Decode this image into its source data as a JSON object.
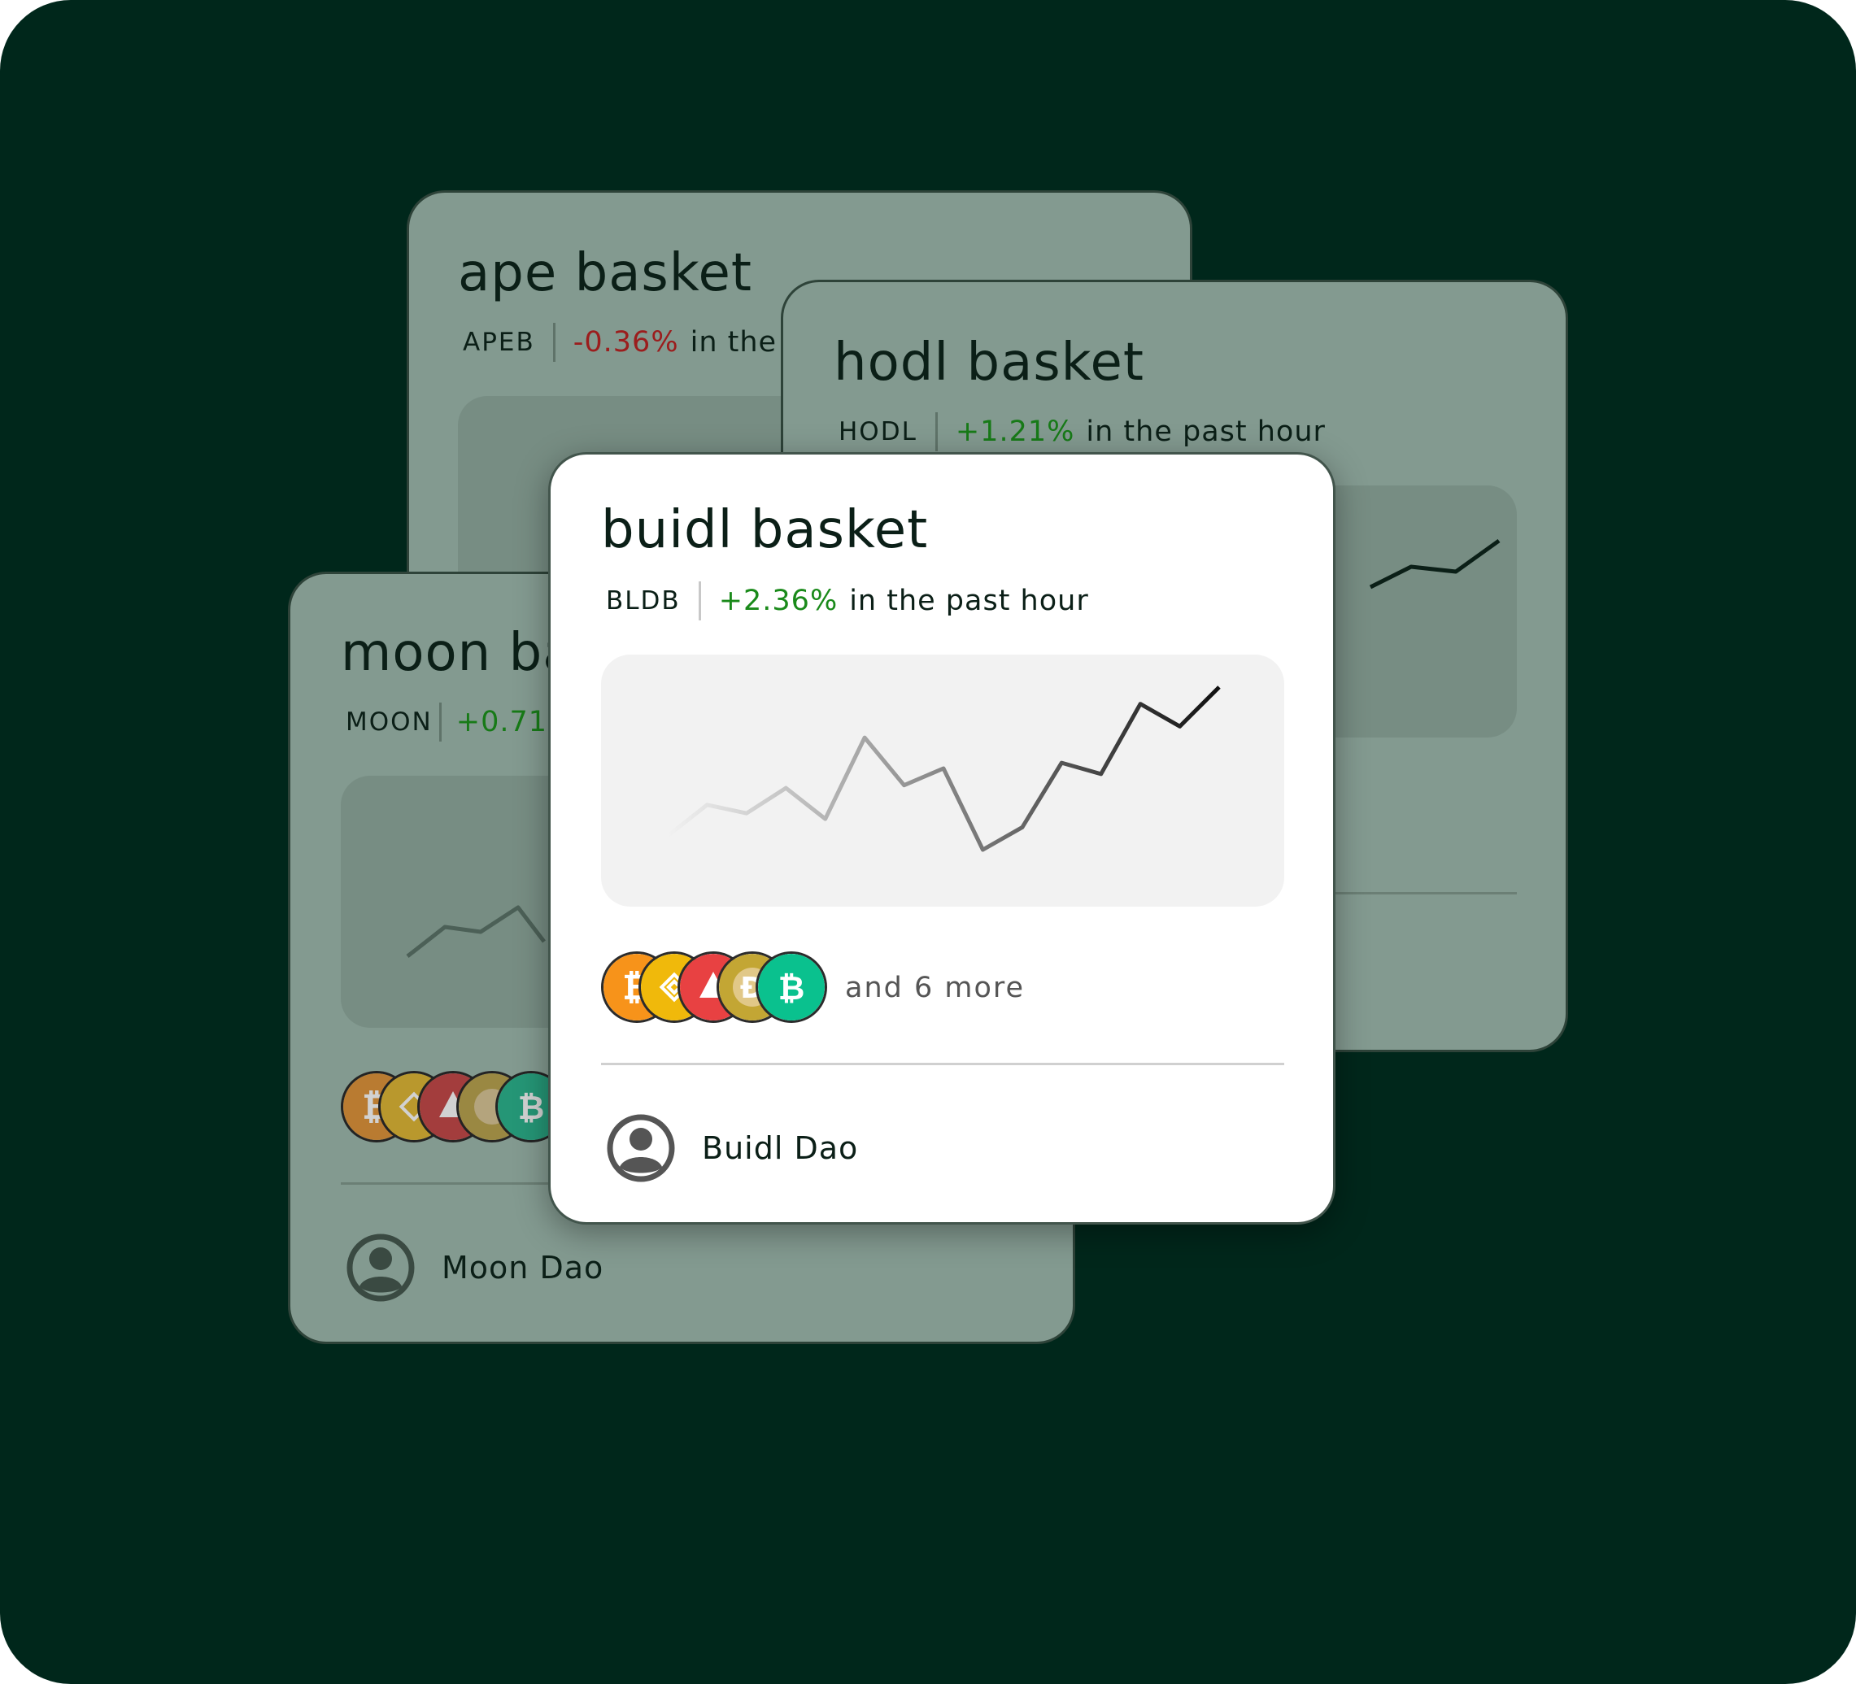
{
  "colors": {
    "background": "#00271b",
    "card_dim": "#839a90",
    "card_front": "#ffffff",
    "positive": "#1a8a1a",
    "negative": "#9b1d1d",
    "coin_btc": "#f7931a",
    "coin_bnb": "#f0b90b",
    "coin_avax": "#e84142",
    "coin_doge": "#c3a634",
    "coin_bch": "#0ac18e"
  },
  "cards": {
    "ape": {
      "title": "ape basket",
      "ticker": "APEB",
      "change": "-0.36%",
      "change_suffix": "in the"
    },
    "hodl": {
      "title": "hodl basket",
      "ticker": "HODL",
      "change": "+1.21%",
      "change_suffix": "in the past hour"
    },
    "moon": {
      "title": "moon ba",
      "ticker": "MOON",
      "change": "+0.71%",
      "owner": "Moon Dao",
      "coins": [
        "bitcoin-icon",
        "bnb-icon",
        "avalanche-icon",
        "dogecoin-icon",
        "bitcoin-cash-icon"
      ]
    },
    "buidl": {
      "title": "buidl basket",
      "ticker": "BLDB",
      "change": "+2.36%",
      "change_suffix": "in the past hour",
      "coins": [
        "bitcoin-icon",
        "bnb-icon",
        "avalanche-icon",
        "dogecoin-icon",
        "bitcoin-cash-icon"
      ],
      "more_label": "and 6 more",
      "owner": "Buidl Dao",
      "sparkline": [
        50,
        61,
        58,
        67,
        56,
        85,
        68,
        74,
        45,
        53,
        76,
        72,
        97,
        89,
        103
      ]
    }
  }
}
